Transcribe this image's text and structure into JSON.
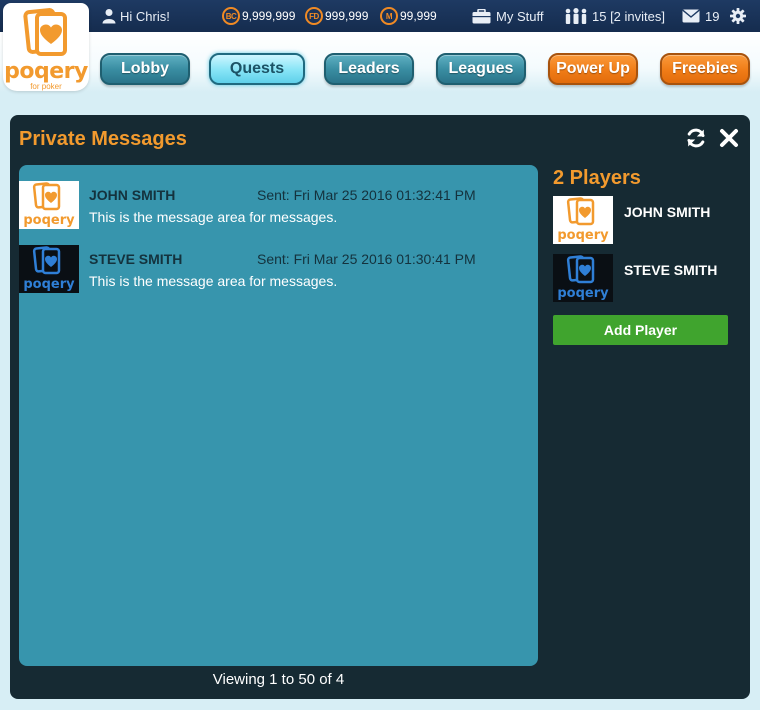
{
  "topbar": {
    "greeting": "Hi Chris!",
    "currencies": [
      {
        "icon": "BC",
        "value": "9,999,999",
        "color": "#f08a24"
      },
      {
        "icon": "FD",
        "value": "999,999",
        "color": "#f08a24"
      },
      {
        "icon": "M",
        "value": "99,999",
        "color": "#f08a24"
      }
    ],
    "my_stuff": "My Stuff",
    "friends": "15 [2 invites]",
    "mail_count": "19"
  },
  "logo": {
    "word": "poqery",
    "tagline": "for poker"
  },
  "nav": {
    "lobby": "Lobby",
    "quests": "Quests",
    "leaders": "Leaders",
    "leagues": "Leagues",
    "power_up": "Power Up",
    "freebies": "Freebies",
    "active": "Quests"
  },
  "panel": {
    "title": "Private Messages",
    "messages": [
      {
        "sender": "JOHN SMITH",
        "sent": "Sent: Fri Mar 25 2016 01:32:41 PM",
        "text": "This is the message area for messages.",
        "avatar_style": "light"
      },
      {
        "sender": "STEVE SMITH",
        "sent": "Sent: Fri Mar 25 2016 01:30:41 PM",
        "text": "This is the message area for messages.",
        "avatar_style": "dark"
      }
    ],
    "pager": "Viewing 1 to 50 of 4"
  },
  "players": {
    "title": "2 Players",
    "list": [
      {
        "name": "JOHN SMITH",
        "avatar_style": "light"
      },
      {
        "name": "STEVE SMITH",
        "avatar_style": "dark"
      }
    ],
    "add_label": "Add Player"
  },
  "colors": {
    "brand_orange": "#f29a2e",
    "panel_bg": "#162a33",
    "message_area": "#3795ad",
    "add_button": "#40a42e",
    "topbar": "#1e3a63"
  },
  "icons": [
    "user-icon",
    "briefcase-icon",
    "group-icon",
    "envelope-icon",
    "gear-icon",
    "refresh-icon",
    "close-icon"
  ]
}
